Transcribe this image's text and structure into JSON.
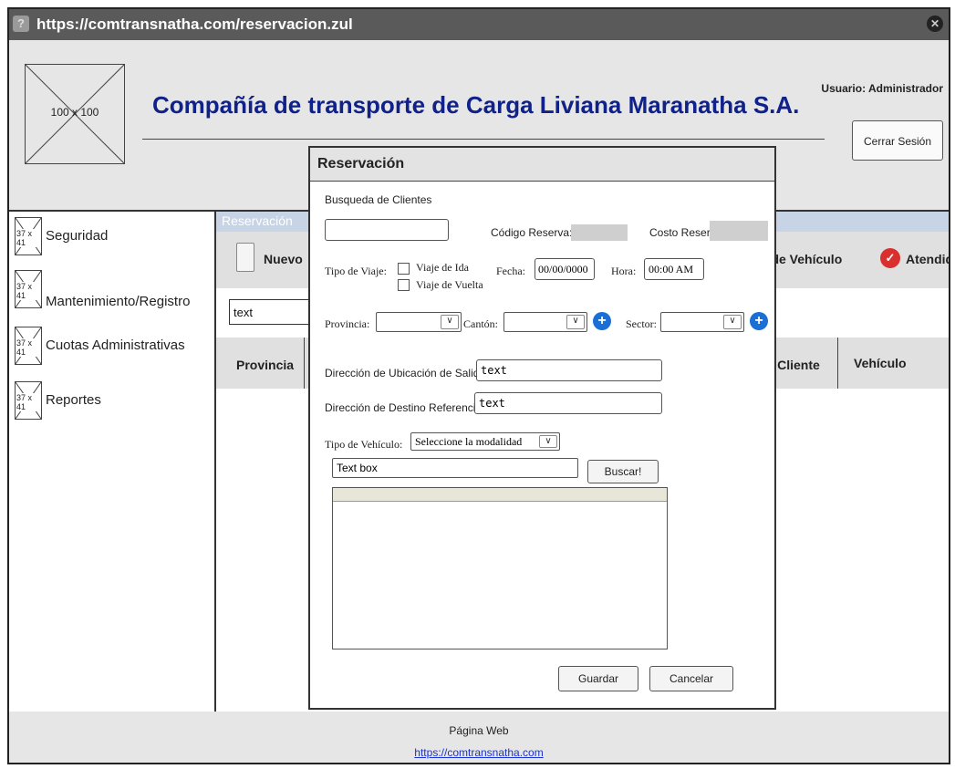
{
  "window": {
    "url": "https://comtransnatha.com/reservacion.zul"
  },
  "header": {
    "logo_label": "100 x 100",
    "company": "Compañía de transporte de Carga Liviana Maranatha S.A.",
    "user": "Usuario: Administrador",
    "logout_label": "Cerrar Sesión"
  },
  "sidebar": {
    "icon_text": "37 x 41",
    "items": [
      {
        "label": "Seguridad"
      },
      {
        "label": "Mantenimiento/Registro"
      },
      {
        "label": "Cuotas Administrativas"
      },
      {
        "label": "Reportes"
      }
    ]
  },
  "main": {
    "breadcrumb": "Reservación",
    "new_label": "Nuevo",
    "vehicle_state_label": "n de Vehículo",
    "attended_label": "Atendido",
    "text_value": "text",
    "columns": {
      "c1": "Provincia",
      "c2": "re Cliente",
      "c3": "Vehículo"
    }
  },
  "modal": {
    "title": "Reservación",
    "search_label": "Busqueda de Clientes",
    "codigo_label": "Código Reserva:",
    "costo_label": "Costo Reserva",
    "tipo_viaje_label": "Tipo de Viaje:",
    "ida_label": "Viaje de Ida",
    "vuelta_label": "Viaje de Vuelta",
    "fecha_label": "Fecha:",
    "fecha_value": "00/00/0000",
    "hora_label": "Hora:",
    "hora_value": "00:00 AM",
    "provincia_label": "Provincia:",
    "canton_label": "Cantón:",
    "sector_label": "Sector:",
    "salida_label": "Dirección de Ubicación de Salida:",
    "salida_value": "text",
    "destino_label": "Dirección de Destino Referencial:",
    "destino_value": "text",
    "tipo_vehiculo_label": "Tipo de Vehículo:",
    "tipo_vehiculo_value": "Seleccione la modalidad",
    "textbox_value": "Text box",
    "buscar_label": "Buscar!",
    "guardar_label": "Guardar",
    "cancelar_label": "Cancelar"
  },
  "footer": {
    "title": "Página Web",
    "link": "https://comtransnatha.com"
  }
}
